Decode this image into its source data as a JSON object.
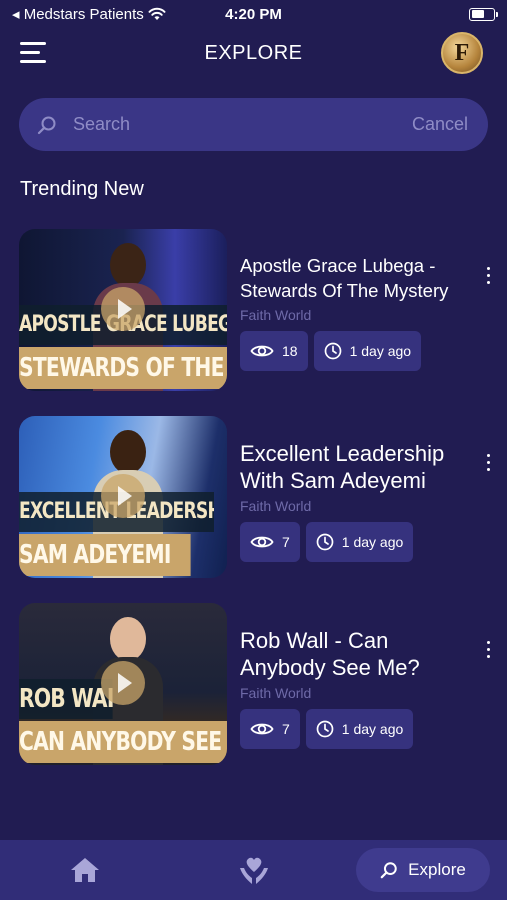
{
  "status_bar": {
    "carrier": "◂ Medstars Patients",
    "time": "4:20 PM",
    "battery_level": 0.6
  },
  "header": {
    "title": "EXPLORE",
    "avatar_letter": "F"
  },
  "search": {
    "placeholder": "Search",
    "cancel_label": "Cancel"
  },
  "section_title": "Trending New",
  "videos": [
    {
      "title": "Apostle Grace Lubega - Stewards Of The Mystery",
      "channel": "Faith World",
      "views": "18",
      "time_ago": "1 day ago",
      "banner_top": "APOSTLE GRACE LUBEGA",
      "banner_bottom": "STEWARDS OF THE MYSTERY"
    },
    {
      "title": "Excellent Leadership With Sam Adeyemi",
      "channel": "Faith World",
      "views": "7",
      "time_ago": "1 day ago",
      "banner_top": "EXCELLENT LEADERSHIP WITH",
      "banner_bottom": "SAM ADEYEMI"
    },
    {
      "title": "Rob Wall - Can Anybody See Me?",
      "channel": "Faith World",
      "views": "7",
      "time_ago": "1 day ago",
      "banner_top": "ROB WALL",
      "banner_bottom": "CAN ANYBODY SEE ME"
    }
  ],
  "bottom_nav": {
    "explore_label": "Explore"
  },
  "colors": {
    "background": "#211c52",
    "search_bg": "#3a3686",
    "pill_bg": "#36327e",
    "nav_bg": "#312d78",
    "accent_gold": "#c9a56a"
  }
}
